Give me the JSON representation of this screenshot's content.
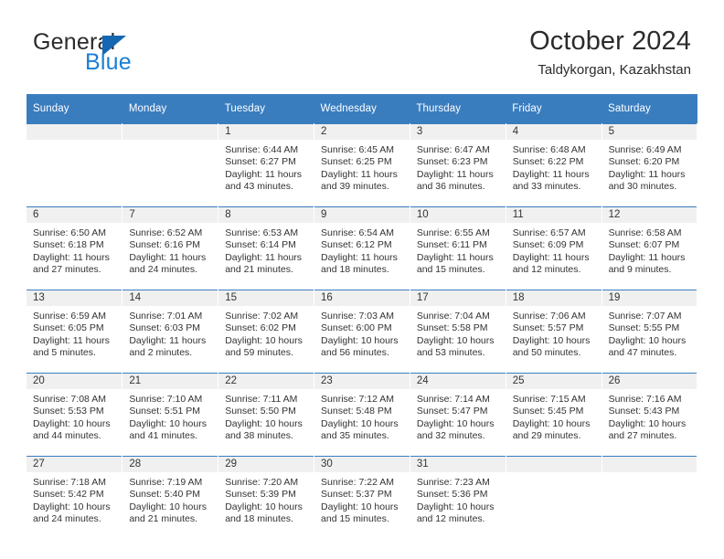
{
  "brand": {
    "word_one": "General",
    "word_two": "Blue",
    "triangle_color": "#1567b2",
    "blue_color": "#1a7fd4"
  },
  "header": {
    "title": "October 2024",
    "subtitle": "Taldykorgan, Kazakhstan"
  },
  "theme": {
    "header_blue": "#3a7dbf",
    "daynum_bar": "#f0f0f0",
    "text": "#333333"
  },
  "weekday_headers": [
    "Sunday",
    "Monday",
    "Tuesday",
    "Wednesday",
    "Thursday",
    "Friday",
    "Saturday"
  ],
  "weeks": [
    [
      {
        "day": "",
        "lines": []
      },
      {
        "day": "",
        "lines": []
      },
      {
        "day": "1",
        "lines": [
          "Sunrise: 6:44 AM",
          "Sunset: 6:27 PM",
          "Daylight: 11 hours",
          "and 43 minutes."
        ]
      },
      {
        "day": "2",
        "lines": [
          "Sunrise: 6:45 AM",
          "Sunset: 6:25 PM",
          "Daylight: 11 hours",
          "and 39 minutes."
        ]
      },
      {
        "day": "3",
        "lines": [
          "Sunrise: 6:47 AM",
          "Sunset: 6:23 PM",
          "Daylight: 11 hours",
          "and 36 minutes."
        ]
      },
      {
        "day": "4",
        "lines": [
          "Sunrise: 6:48 AM",
          "Sunset: 6:22 PM",
          "Daylight: 11 hours",
          "and 33 minutes."
        ]
      },
      {
        "day": "5",
        "lines": [
          "Sunrise: 6:49 AM",
          "Sunset: 6:20 PM",
          "Daylight: 11 hours",
          "and 30 minutes."
        ]
      }
    ],
    [
      {
        "day": "6",
        "lines": [
          "Sunrise: 6:50 AM",
          "Sunset: 6:18 PM",
          "Daylight: 11 hours",
          "and 27 minutes."
        ]
      },
      {
        "day": "7",
        "lines": [
          "Sunrise: 6:52 AM",
          "Sunset: 6:16 PM",
          "Daylight: 11 hours",
          "and 24 minutes."
        ]
      },
      {
        "day": "8",
        "lines": [
          "Sunrise: 6:53 AM",
          "Sunset: 6:14 PM",
          "Daylight: 11 hours",
          "and 21 minutes."
        ]
      },
      {
        "day": "9",
        "lines": [
          "Sunrise: 6:54 AM",
          "Sunset: 6:12 PM",
          "Daylight: 11 hours",
          "and 18 minutes."
        ]
      },
      {
        "day": "10",
        "lines": [
          "Sunrise: 6:55 AM",
          "Sunset: 6:11 PM",
          "Daylight: 11 hours",
          "and 15 minutes."
        ]
      },
      {
        "day": "11",
        "lines": [
          "Sunrise: 6:57 AM",
          "Sunset: 6:09 PM",
          "Daylight: 11 hours",
          "and 12 minutes."
        ]
      },
      {
        "day": "12",
        "lines": [
          "Sunrise: 6:58 AM",
          "Sunset: 6:07 PM",
          "Daylight: 11 hours",
          "and 9 minutes."
        ]
      }
    ],
    [
      {
        "day": "13",
        "lines": [
          "Sunrise: 6:59 AM",
          "Sunset: 6:05 PM",
          "Daylight: 11 hours",
          "and 5 minutes."
        ]
      },
      {
        "day": "14",
        "lines": [
          "Sunrise: 7:01 AM",
          "Sunset: 6:03 PM",
          "Daylight: 11 hours",
          "and 2 minutes."
        ]
      },
      {
        "day": "15",
        "lines": [
          "Sunrise: 7:02 AM",
          "Sunset: 6:02 PM",
          "Daylight: 10 hours",
          "and 59 minutes."
        ]
      },
      {
        "day": "16",
        "lines": [
          "Sunrise: 7:03 AM",
          "Sunset: 6:00 PM",
          "Daylight: 10 hours",
          "and 56 minutes."
        ]
      },
      {
        "day": "17",
        "lines": [
          "Sunrise: 7:04 AM",
          "Sunset: 5:58 PM",
          "Daylight: 10 hours",
          "and 53 minutes."
        ]
      },
      {
        "day": "18",
        "lines": [
          "Sunrise: 7:06 AM",
          "Sunset: 5:57 PM",
          "Daylight: 10 hours",
          "and 50 minutes."
        ]
      },
      {
        "day": "19",
        "lines": [
          "Sunrise: 7:07 AM",
          "Sunset: 5:55 PM",
          "Daylight: 10 hours",
          "and 47 minutes."
        ]
      }
    ],
    [
      {
        "day": "20",
        "lines": [
          "Sunrise: 7:08 AM",
          "Sunset: 5:53 PM",
          "Daylight: 10 hours",
          "and 44 minutes."
        ]
      },
      {
        "day": "21",
        "lines": [
          "Sunrise: 7:10 AM",
          "Sunset: 5:51 PM",
          "Daylight: 10 hours",
          "and 41 minutes."
        ]
      },
      {
        "day": "22",
        "lines": [
          "Sunrise: 7:11 AM",
          "Sunset: 5:50 PM",
          "Daylight: 10 hours",
          "and 38 minutes."
        ]
      },
      {
        "day": "23",
        "lines": [
          "Sunrise: 7:12 AM",
          "Sunset: 5:48 PM",
          "Daylight: 10 hours",
          "and 35 minutes."
        ]
      },
      {
        "day": "24",
        "lines": [
          "Sunrise: 7:14 AM",
          "Sunset: 5:47 PM",
          "Daylight: 10 hours",
          "and 32 minutes."
        ]
      },
      {
        "day": "25",
        "lines": [
          "Sunrise: 7:15 AM",
          "Sunset: 5:45 PM",
          "Daylight: 10 hours",
          "and 29 minutes."
        ]
      },
      {
        "day": "26",
        "lines": [
          "Sunrise: 7:16 AM",
          "Sunset: 5:43 PM",
          "Daylight: 10 hours",
          "and 27 minutes."
        ]
      }
    ],
    [
      {
        "day": "27",
        "lines": [
          "Sunrise: 7:18 AM",
          "Sunset: 5:42 PM",
          "Daylight: 10 hours",
          "and 24 minutes."
        ]
      },
      {
        "day": "28",
        "lines": [
          "Sunrise: 7:19 AM",
          "Sunset: 5:40 PM",
          "Daylight: 10 hours",
          "and 21 minutes."
        ]
      },
      {
        "day": "29",
        "lines": [
          "Sunrise: 7:20 AM",
          "Sunset: 5:39 PM",
          "Daylight: 10 hours",
          "and 18 minutes."
        ]
      },
      {
        "day": "30",
        "lines": [
          "Sunrise: 7:22 AM",
          "Sunset: 5:37 PM",
          "Daylight: 10 hours",
          "and 15 minutes."
        ]
      },
      {
        "day": "31",
        "lines": [
          "Sunrise: 7:23 AM",
          "Sunset: 5:36 PM",
          "Daylight: 10 hours",
          "and 12 minutes."
        ]
      },
      {
        "day": "",
        "lines": []
      },
      {
        "day": "",
        "lines": []
      }
    ]
  ]
}
